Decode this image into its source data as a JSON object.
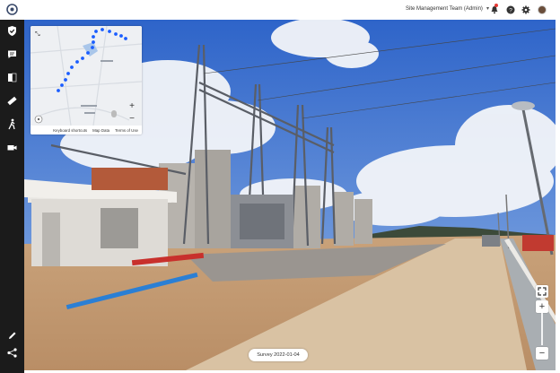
{
  "header": {
    "team_name": "Site Management Team (Admin)",
    "icons": [
      "notification-bell-icon",
      "help-icon",
      "settings-gear-icon",
      "user-avatar"
    ],
    "notification_badge_color": "#e53935"
  },
  "sidebar": {
    "top_items": [
      "shield-check-icon",
      "chat-icon",
      "compare-icon",
      "measure-ruler-icon",
      "walk-icon",
      "video-camera-icon"
    ],
    "bottom_items": [
      "pencil-icon",
      "share-icon"
    ]
  },
  "minimap": {
    "labels": [
      "Keyboard shortcuts",
      "Map Data",
      "Terms of Use"
    ],
    "zoom_in": "+",
    "zoom_out": "−",
    "route_color": "#1a5dff"
  },
  "viewer": {
    "fullscreen": "fullscreen-icon",
    "zoom_in": "+",
    "zoom_out": "−"
  },
  "survey": {
    "label": "Survey 2022-01-04"
  },
  "colors": {
    "sidebar": "#1b1b1b",
    "sky": "#3b73d6"
  }
}
